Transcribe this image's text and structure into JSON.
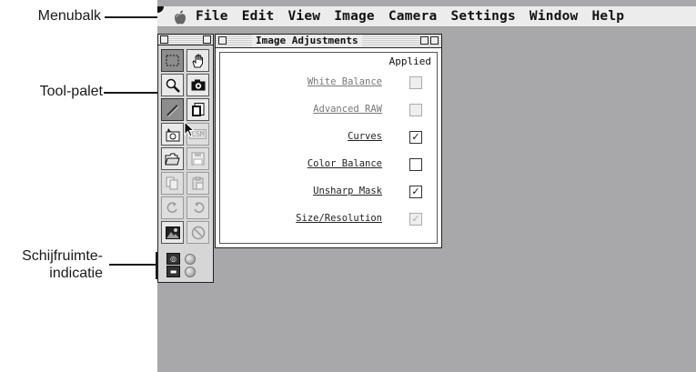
{
  "annotations": {
    "menubar_label": "Menubalk",
    "tool_palette_label": "Tool-palet",
    "disk_space_label_line1": "Schijfruimte-",
    "disk_space_label_line2": "indicatie"
  },
  "menubar": {
    "apple_icon": "apple-icon",
    "items": [
      "File",
      "Edit",
      "View",
      "Image",
      "Camera",
      "Settings",
      "Window",
      "Help"
    ]
  },
  "tool_palette": {
    "tools": [
      {
        "icon": "marquee-select-icon",
        "state": "active"
      },
      {
        "icon": "hand-icon",
        "state": "enabled"
      },
      {
        "icon": "magnifier-icon",
        "state": "enabled"
      },
      {
        "icon": "camera-icon",
        "state": "enabled"
      },
      {
        "icon": "pencil-icon",
        "state": "active"
      },
      {
        "icon": "page-icon",
        "state": "enabled"
      },
      {
        "icon": "camera-control-icon",
        "state": "enabled"
      },
      {
        "icon": "csm-icon",
        "state": "dimmed"
      },
      {
        "icon": "open-folder-icon",
        "state": "enabled"
      },
      {
        "icon": "save-disk-icon",
        "state": "dimmed"
      },
      {
        "icon": "copy-icon",
        "state": "dimmed"
      },
      {
        "icon": "paste-icon",
        "state": "dimmed"
      },
      {
        "icon": "rotate-right-icon",
        "state": "dimmed"
      },
      {
        "icon": "rotate-left-icon",
        "state": "dimmed"
      },
      {
        "icon": "image-icon",
        "state": "enabled"
      },
      {
        "icon": "prohibit-icon",
        "state": "dimmed"
      }
    ],
    "csm_label": "CSM",
    "disk_indicators": [
      {
        "icon": "camera-card-icon"
      },
      {
        "icon": "hard-disk-icon"
      }
    ]
  },
  "image_adjustments": {
    "title": "Image Adjustments",
    "applied_header": "Applied",
    "rows": [
      {
        "label": "White Balance",
        "checked": false,
        "enabled": false
      },
      {
        "label": "Advanced RAW",
        "checked": false,
        "enabled": false
      },
      {
        "label": "Curves",
        "checked": true,
        "enabled": true
      },
      {
        "label": "Color Balance",
        "checked": false,
        "enabled": true
      },
      {
        "label": "Unsharp Mask",
        "checked": true,
        "enabled": true
      },
      {
        "label": "Size/Resolution",
        "checked": true,
        "enabled": false
      }
    ]
  },
  "colors": {
    "desktop": "#a8a8aa",
    "menubar": "#ececec",
    "window": "#ffffff"
  }
}
